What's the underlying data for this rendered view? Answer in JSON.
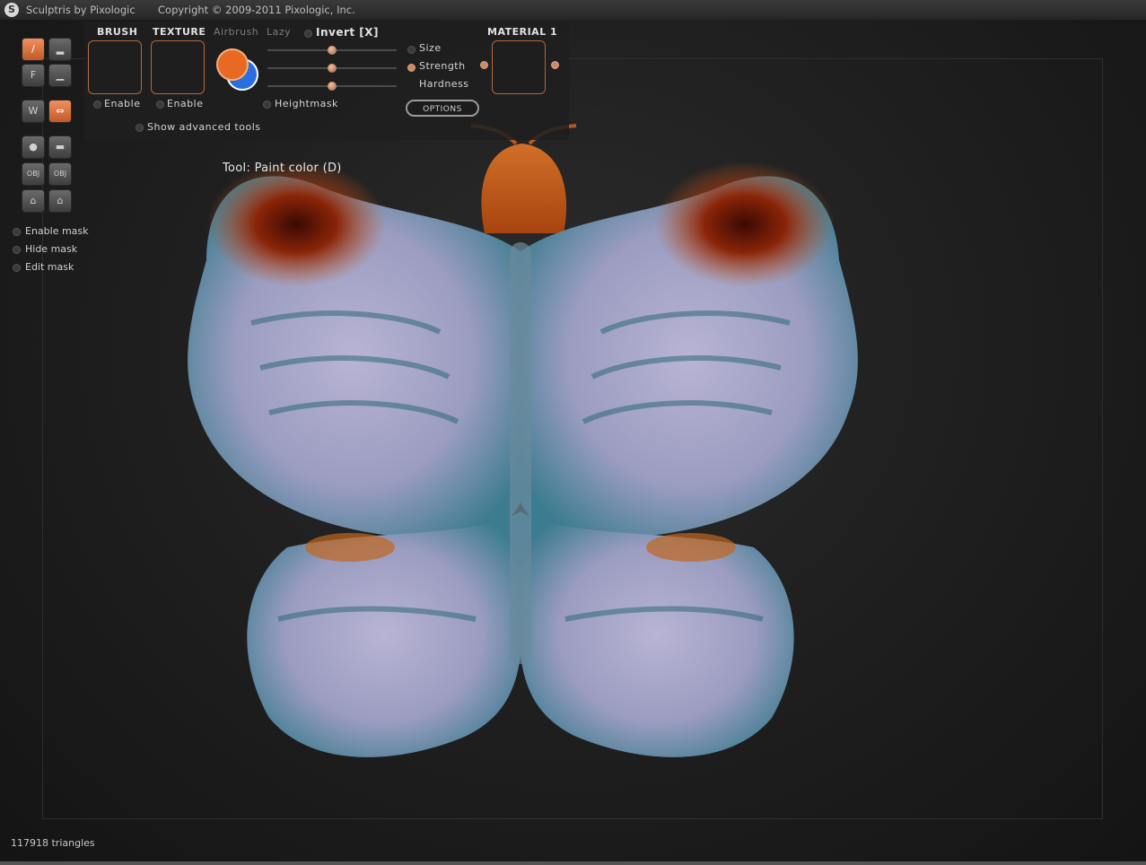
{
  "titlebar": {
    "title": "Sculptris by Pixologic",
    "copyright": "Copyright © 2009-2011 Pixologic, Inc."
  },
  "toppanel": {
    "brush_label": "BRUSH",
    "texture_label": "TEXTURE",
    "airbrush_label": "Airbrush",
    "lazy_label": "Lazy",
    "invert_label": "Invert [X]",
    "brush_enable": "Enable",
    "texture_enable": "Enable",
    "size_label": "Size",
    "strength_label": "Strength",
    "hardness_label": "Hardness",
    "heightmask_label": "Heightmask",
    "options_label": "OPTIONS",
    "material_label": "MATERIAL 1",
    "show_advanced": "Show advanced tools",
    "colors": {
      "primary": "#e86a22",
      "secondary": "#2a6ee0"
    },
    "slider_values": {
      "size": 0.5,
      "strength": 0.5,
      "hardness": 0.5
    }
  },
  "tools": {
    "row1": [
      "draw-tool",
      "flatten-tool"
    ],
    "row2": [
      "F",
      "inflate-tool"
    ],
    "row3": [
      "symmetry-tool",
      "grab-tool"
    ],
    "row4": [
      "sphere-tool",
      "plane-tool"
    ],
    "row5": [
      "OBJ",
      "OBJ"
    ],
    "row6": [
      "import-tool",
      "export-tool"
    ]
  },
  "mask": {
    "enable": "Enable mask",
    "hide": "Hide mask",
    "edit": "Edit mask"
  },
  "viewport": {
    "tool_label": "Tool: Paint color (D)",
    "body_color": "#9a9cc0",
    "accent_color": "#b84a12"
  },
  "status": {
    "triangles": "117918 triangles"
  }
}
